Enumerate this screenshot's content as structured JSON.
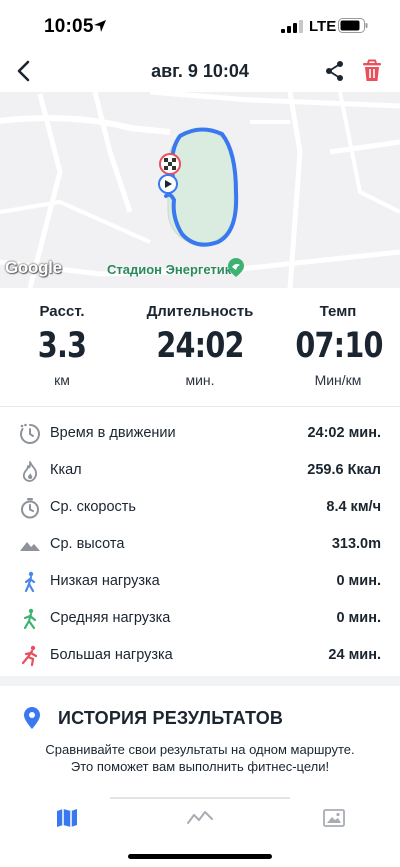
{
  "status_bar": {
    "time": "10:05",
    "network": "LTE"
  },
  "nav": {
    "title": "авг. 9  10:04"
  },
  "map": {
    "stadium_label": "Стадион Энергетик",
    "provider": "Google",
    "route_color": "#3a78f0"
  },
  "summary": [
    {
      "label": "Расст.",
      "value": "3.3",
      "unit": "км"
    },
    {
      "label": "Длительность",
      "value": "24:02",
      "unit": "мин."
    },
    {
      "label": "Темп",
      "value": "07:10",
      "unit": "Мин/км"
    }
  ],
  "stats": [
    {
      "icon": "moving-time-icon",
      "label": "Время в движении",
      "value": "24:02 мин."
    },
    {
      "icon": "flame-icon",
      "label": "Ккал",
      "value": "259.6 Ккал"
    },
    {
      "icon": "stopwatch-icon",
      "label": "Ср. скорость",
      "value": "8.4 км/ч"
    },
    {
      "icon": "mountain-icon",
      "label": "Ср. высота",
      "value": "313.0m"
    },
    {
      "icon": "walker-icon",
      "label": "Низкая нагрузка",
      "value": "0 мин."
    },
    {
      "icon": "walker-icon",
      "label": "Средняя нагрузка",
      "value": "0 мин."
    },
    {
      "icon": "runner-icon",
      "label": "Большая нагрузка",
      "value": "24 мин."
    }
  ],
  "history": {
    "title": "ИСТОРИЯ РЕЗУЛЬТАТОВ",
    "description_line1": "Сравнивайте свои результаты на одном маршруте.",
    "description_line2": "Это поможет вам выполнить фитнес-цели!"
  },
  "tabs": [
    {
      "icon": "map-icon",
      "active": true
    },
    {
      "icon": "chart-line-icon",
      "active": false
    },
    {
      "icon": "photo-icon",
      "active": false
    }
  ],
  "colors": {
    "accent": "#3a78f0",
    "danger": "#e8505b",
    "low": "#4a87e8",
    "medium": "#3cb371",
    "high": "#e8505b"
  }
}
